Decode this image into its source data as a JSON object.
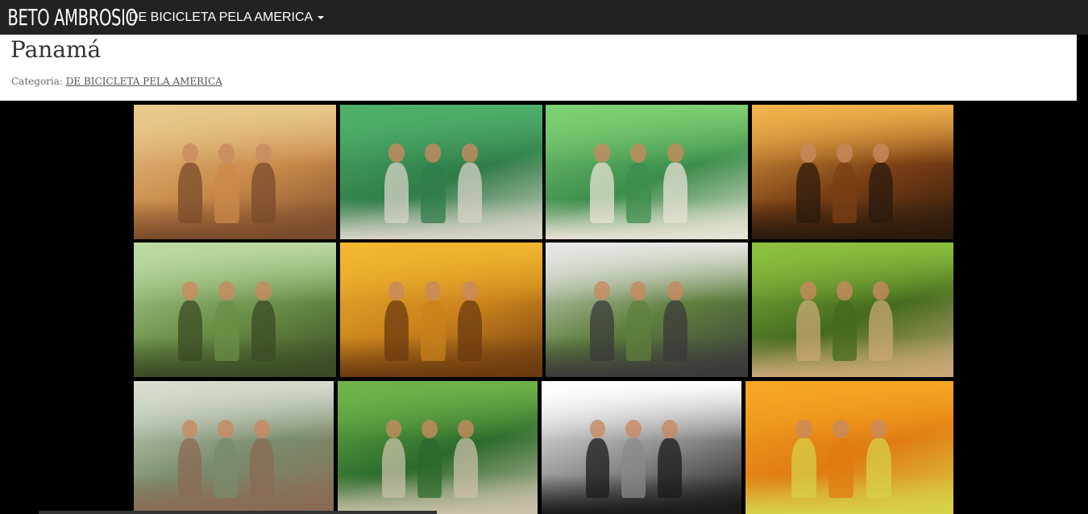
{
  "navbar": {
    "brand": "BETO AMBROSIO",
    "menu_label": "DE BICICLETA PELA AMERICA"
  },
  "page": {
    "title": "Panamá",
    "category_label": "Categoria:",
    "category_link": "DE BICICLETA PELA AMERICA"
  },
  "gallery": {
    "photos": [
      {
        "id": "photo-1",
        "palette": [
          "#e9c98c",
          "#c98a4a",
          "#7a4b2b"
        ]
      },
      {
        "id": "photo-2",
        "palette": [
          "#4fb06a",
          "#2f7c48",
          "#d8d3c7"
        ]
      },
      {
        "id": "photo-3",
        "palette": [
          "#7ccf72",
          "#3c8d4c",
          "#e8e2d4"
        ]
      },
      {
        "id": "photo-4",
        "palette": [
          "#f0b04a",
          "#7b3f14",
          "#2a1a0d"
        ]
      },
      {
        "id": "photo-5",
        "palette": [
          "#bcd9a2",
          "#6a8f46",
          "#3b4a24"
        ]
      },
      {
        "id": "photo-6",
        "palette": [
          "#f2b62f",
          "#c9821c",
          "#6b3a10"
        ]
      },
      {
        "id": "photo-7",
        "palette": [
          "#e4e7e2",
          "#5f7f3d",
          "#3a3a3a"
        ]
      },
      {
        "id": "photo-8",
        "palette": [
          "#8bbf3d",
          "#446a1f",
          "#caa777"
        ]
      },
      {
        "id": "photo-9",
        "palette": [
          "#d6ddd0",
          "#7a8b6c",
          "#8a6a53"
        ]
      },
      {
        "id": "photo-10",
        "palette": [
          "#6fb44a",
          "#2b6a2b",
          "#c9c0a8"
        ]
      },
      {
        "id": "photo-11",
        "palette": [
          "#ffffff",
          "#8a8a8a",
          "#1a1a1a"
        ]
      },
      {
        "id": "photo-12",
        "palette": [
          "#f5a623",
          "#e07b12",
          "#d7d04a"
        ]
      }
    ]
  }
}
